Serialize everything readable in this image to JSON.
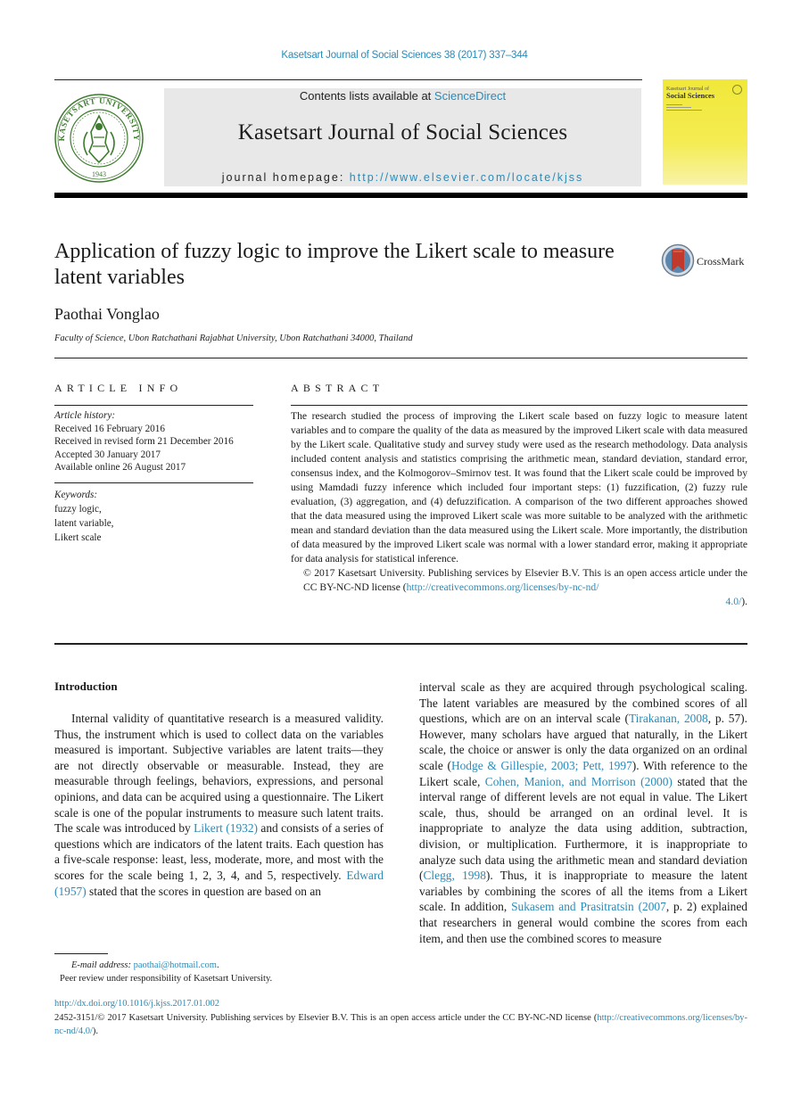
{
  "running_head": "Kasetsart Journal of Social Sciences 38 (2017) 337–344",
  "banner": {
    "contents_prefix": "Contents lists available at ",
    "contents_link": "ScienceDirect",
    "journal_title": "Kasetsart Journal of Social Sciences",
    "homepage_prefix": "journal homepage: ",
    "homepage_link": "http://www.elsevier.com/locate/kjss"
  },
  "logo": {
    "name": "KASETSART UNIVERSITY",
    "year": "1943",
    "color": "#3e7b2e"
  },
  "cover": {
    "line1": "Kasetsart Journal of",
    "line2": "Social Sciences",
    "color": "#f1e83a"
  },
  "article": {
    "title": "Application of fuzzy logic to improve the Likert scale to measure latent variables",
    "author": "Paothai Vonglao",
    "affiliation": "Faculty of Science, Ubon Ratchathani Rajabhat University, Ubon Ratchathani 34000, Thailand",
    "crossmark_label": "CrossMark"
  },
  "article_info": {
    "heading": "ARTICLE INFO",
    "history_label": "Article history:",
    "history": [
      "Received 16 February 2016",
      "Received in revised form 21 December 2016",
      "Accepted 30 January 2017",
      "Available online 26 August 2017"
    ],
    "keywords_label": "Keywords:",
    "keywords": [
      "fuzzy logic,",
      "latent variable,",
      "Likert scale"
    ]
  },
  "abstract": {
    "heading": "ABSTRACT",
    "text": "The research studied the process of improving the Likert scale based on fuzzy logic to measure latent variables and to compare the quality of the data as measured by the improved Likert scale with data measured by the Likert scale. Qualitative study and survey study were used as the research methodology. Data analysis included content analysis and statistics comprising the arithmetic mean, standard deviation, standard error, consensus index, and the Kolmogorov–Smirnov test. It was found that the Likert scale could be improved by using Mamdadi fuzzy inference which included four important steps: (1) fuzzification, (2) fuzzy rule evaluation, (3) aggregation, and (4) defuzzification. A comparison of the two different approaches showed that the data measured using the improved Likert scale was more suitable to be analyzed with the arithmetic mean and standard deviation than the data measured using the Likert scale. More importantly, the distribution of data measured by the improved Likert scale was normal with a lower standard error, making it appropriate for data analysis for statistical inference.",
    "copyright_prefix": "© 2017 Kasetsart University. Publishing services by Elsevier B.V. This is an open access article under the CC BY-NC-ND license (",
    "copyright_link_a": "http://creativecommons.org/licenses/by-nc-nd/",
    "copyright_link_b": "4.0/",
    "copyright_suffix": ")."
  },
  "introduction": {
    "heading": "Introduction",
    "left": {
      "t1": "Internal validity of quantitative research is a measured validity. Thus, the instrument which is used to collect data on the variables measured is important. Subjective variables are latent traits—they are not directly observable or measurable. Instead, they are measurable through feelings, behaviors, expressions, and personal opinions, and data can be acquired using a questionnaire. The Likert scale is one of the popular instruments to measure such latent traits. The scale was introduced by ",
      "c1": "Likert (1932)",
      "t2": " and consists of a series of questions which are indicators of the latent traits. Each question has a five-scale response: least, less, moderate, more, and most with the scores for the scale being 1, 2, 3, 4, and 5, respectively. ",
      "c2": "Edward (1957)",
      "t3": " stated that the scores in question are based on an"
    },
    "right": {
      "t1": "interval scale as they are acquired through psychological scaling. The latent variables are measured by the combined scores of all questions, which are on an interval scale (",
      "c1": "Tirakanan, 2008",
      "t2": ", p. 57). However, many scholars have argued that naturally, in the Likert scale, the choice or answer is only the data organized on an ordinal scale (",
      "c2": "Hodge & Gillespie, 2003; Pett, 1997",
      "t3": "). With reference to the Likert scale, ",
      "c3": "Cohen, Manion, and Morrison (2000)",
      "t4": " stated that the interval range of different levels are not equal in value. The Likert scale, thus, should be arranged on an ordinal level. It is inappropriate to analyze the data using addition, subtraction, division, or multiplication. Furthermore, it is inappropriate to analyze such data using the arithmetic mean and standard deviation (",
      "c4": "Clegg, 1998",
      "t5": "). Thus, it is inappropriate to measure the latent variables by combining the scores of all the items from a Likert scale. In addition, ",
      "c5": "Sukasem and Prasitratsin (2007",
      "t6": ", p. 2) explained that researchers in general would combine the scores from each item, and then use the combined scores to measure"
    }
  },
  "footnotes": {
    "email_label": "E-mail address:",
    "email": "paothai@hotmail.com",
    "email_suffix": ".",
    "peer_review": "Peer review under responsibility of Kasetsart University."
  },
  "footer": {
    "doi": "http://dx.doi.org/10.1016/j.kjss.2017.01.002",
    "license_prefix": "2452-3151/© 2017 Kasetsart University. Publishing services by Elsevier B.V. This is an open access article under the CC BY-NC-ND license (",
    "license_link": "http://creativecommons.org/licenses/by-nc-nd/4.0/",
    "license_suffix": ")."
  },
  "colors": {
    "link": "#2a8ab8",
    "banner_bg": "#e8e8e8",
    "crossmark_red": "#c0392b"
  }
}
